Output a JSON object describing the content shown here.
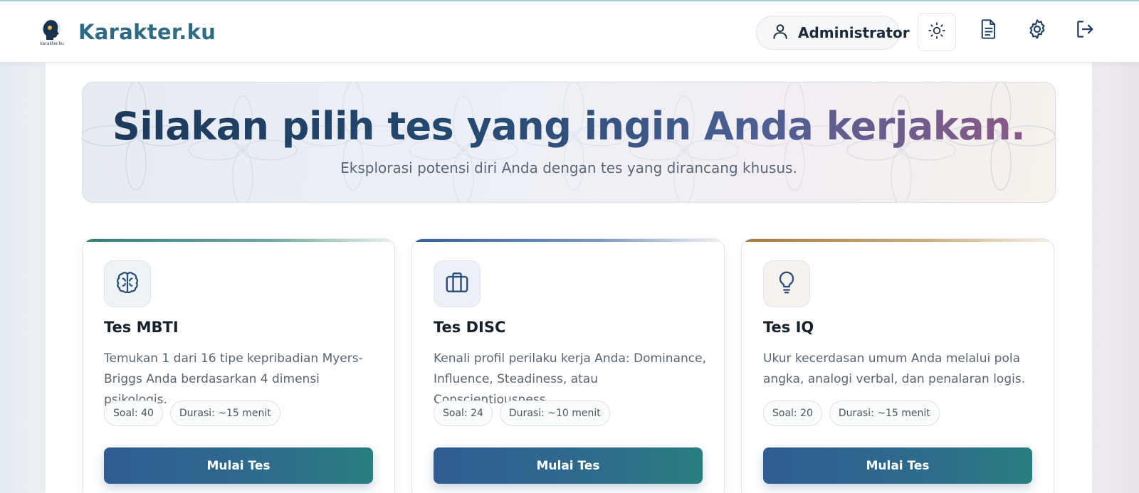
{
  "header": {
    "brand_name": "Karakter.ku",
    "logo_caption": "karakter.ku",
    "user_label": "Administrator"
  },
  "hero": {
    "title": "Silakan pilih tes yang ingin Anda kerjakan.",
    "subtitle": "Eksplorasi potensi diri Anda dengan tes yang dirancang khusus."
  },
  "tests": [
    {
      "icon": "brain-icon",
      "title": "Tes MBTI",
      "description": "Temukan 1 dari 16 tipe kepribadian Myers-Briggs Anda berdasarkan 4 dimensi psikologis.",
      "questions": "Soal: 40",
      "duration": "Durasi: ~15 menit",
      "button_label": "Mulai Tes",
      "accent_color": "#2f7f7a"
    },
    {
      "icon": "briefcase-icon",
      "title": "Tes DISC",
      "description": "Kenali profil perilaku kerja Anda: Dominance, Influence, Steadiness, atau Conscientiousness.",
      "questions": "Soal: 24",
      "duration": "Durasi: ~10 menit",
      "button_label": "Mulai Tes",
      "accent_color": "#35609a"
    },
    {
      "icon": "lightbulb-icon",
      "title": "Tes IQ",
      "description": "Ukur kecerdasan umum Anda melalui pola angka, analogi verbal, dan penalaran logis.",
      "questions": "Soal: 20",
      "duration": "Durasi: ~15 menit",
      "button_label": "Mulai Tes",
      "accent_color": "#a87a3a"
    }
  ],
  "colors": {
    "brand": "#2e6c86",
    "button_start": "#2f5d93",
    "button_end": "#2a7f80"
  }
}
